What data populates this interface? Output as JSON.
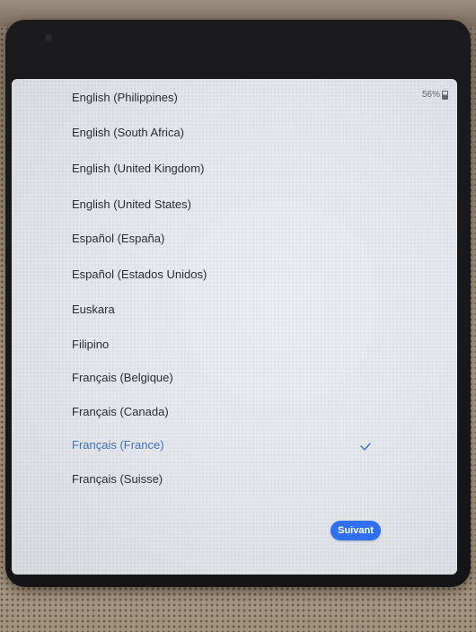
{
  "status_bar": {
    "battery": "56%"
  },
  "languages": [
    {
      "label": "English (Philippines)"
    },
    {
      "label": "English (South Africa)"
    },
    {
      "label": "English (United Kingdom)"
    },
    {
      "label": "English (United States)"
    },
    {
      "label": "Español (España)"
    },
    {
      "label": "Español (Estados Unidos)"
    },
    {
      "label": "Euskara"
    },
    {
      "label": "Filipino"
    },
    {
      "label": "Français (Belgique)"
    },
    {
      "label": "Français (Canada)"
    },
    {
      "label": "Français (France)"
    },
    {
      "label": "Français (Suisse)"
    }
  ],
  "selected_language": "Français (France)",
  "next_button": {
    "label": "Suivant"
  },
  "colors": {
    "selected_text": "#3f6fc6",
    "button": "#2f6ff0"
  },
  "icons": {
    "check": "check-icon",
    "battery": "battery-icon"
  }
}
